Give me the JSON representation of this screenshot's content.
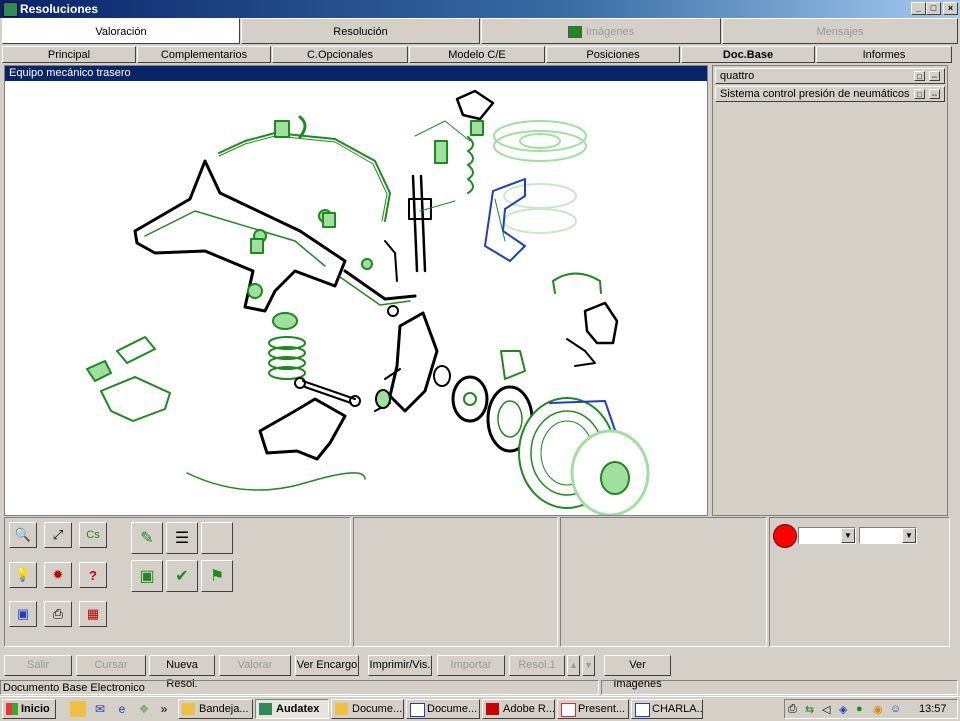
{
  "window": {
    "title": "Resoluciones",
    "controls": [
      "_",
      "□",
      "×"
    ]
  },
  "main_tabs": [
    {
      "label": "Valoración",
      "selected": true,
      "disabled": false
    },
    {
      "label": "Resolución",
      "selected": false,
      "disabled": false
    },
    {
      "label": "Imágenes",
      "selected": false,
      "disabled": true
    },
    {
      "label": "Mensajes",
      "selected": false,
      "disabled": true
    }
  ],
  "sub_tabs": [
    {
      "label": "Principal",
      "selected": false
    },
    {
      "label": "Complementarios",
      "selected": false
    },
    {
      "label": "C.Opcionales",
      "selected": false
    },
    {
      "label": "Modelo C/E",
      "selected": false
    },
    {
      "label": "Posiciones",
      "selected": false
    },
    {
      "label": "Doc.Base",
      "selected": true
    },
    {
      "label": "Informes",
      "selected": false
    }
  ],
  "diagram": {
    "title": "Equipo mecánico trasero",
    "colors": {
      "part": "#1c8a1c",
      "highlight": "#000000",
      "light": "#9fe09f",
      "accent": "#1f3fbf"
    }
  },
  "doc_list": [
    {
      "label": "quattro"
    },
    {
      "label": "Sistema control presión de neumáticos"
    }
  ],
  "tools": {
    "small": [
      {
        "name": "zoom-in-icon",
        "glyph": "🔍"
      },
      {
        "name": "fit-view-icon",
        "glyph": "⤢"
      },
      {
        "name": "cs-icon",
        "glyph": "Cs"
      },
      {
        "name": "lightbulb-icon",
        "glyph": "💡"
      },
      {
        "name": "bug-icon",
        "glyph": "✹"
      },
      {
        "name": "help-icon",
        "glyph": "?"
      },
      {
        "name": "image-color-icon",
        "glyph": "▣"
      },
      {
        "name": "print-icon",
        "glyph": "⎙"
      },
      {
        "name": "calendar-icon",
        "glyph": "▦"
      }
    ],
    "large": [
      {
        "name": "edit-pencil-icon",
        "glyph": "✎"
      },
      {
        "name": "document-list-icon",
        "glyph": "☰"
      },
      {
        "name": "camera-icon",
        "glyph": "▣"
      },
      {
        "name": "checkmark-tool-icon",
        "glyph": "✔"
      },
      {
        "name": "flag-tool-icon",
        "glyph": "⚑"
      }
    ]
  },
  "indicator_color": "#ff0000",
  "actions": [
    {
      "label": "Salir",
      "disabled": true
    },
    {
      "label": "Cursar",
      "disabled": true
    },
    {
      "label": "Nueva Resol.",
      "disabled": false
    },
    {
      "label": "Valorar",
      "disabled": true
    },
    {
      "label": "Ver Encargo",
      "disabled": false
    },
    {
      "label": "Imprimir/Vis.",
      "disabled": false
    },
    {
      "label": "Importar",
      "disabled": true
    },
    {
      "label": "Resol.1",
      "disabled": true
    },
    {
      "label": "Ver Imagenes",
      "disabled": false
    }
  ],
  "status_text": "Documento Base Electronico",
  "taskbar": {
    "start_label": "Inicio",
    "quick_launch_more": "»",
    "items": [
      {
        "label": "Bandeja...",
        "active": false
      },
      {
        "label": "Audatex",
        "active": true
      },
      {
        "label": "Docume...",
        "active": false
      },
      {
        "label": "Docume...",
        "active": false
      },
      {
        "label": "Adobe R...",
        "active": false
      },
      {
        "label": "Present...",
        "active": false
      },
      {
        "label": "CHARLA...",
        "active": false
      }
    ],
    "clock": "13:57"
  }
}
